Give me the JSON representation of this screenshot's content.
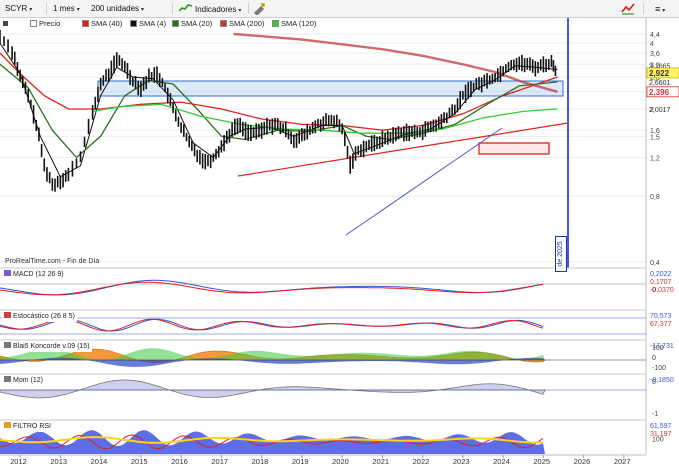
{
  "toolbar": {
    "symbol": "SCYR",
    "timeframe": "1 mes",
    "units": "200 unidades",
    "indicators": "Indicadores"
  },
  "colors": {
    "price": "#111111",
    "sma40": "#e02020",
    "sma4": "#111111",
    "sma20": "#2e6e1e",
    "sma200": "#c03a3a",
    "sma120": "#33cc33",
    "vline": "#1f2fd0",
    "zone_blue": "#2f6fd6",
    "zone_red": "#e03030"
  },
  "legend": [
    {
      "label": "Precio",
      "color": "#ffffff"
    },
    {
      "label": "SMA (40)",
      "color": "#e02020"
    },
    {
      "label": "SMA (4)",
      "color": "#111111"
    },
    {
      "label": "SMA (20)",
      "color": "#2e6e1e"
    },
    {
      "label": "SMA (200)",
      "color": "#c03a3a"
    },
    {
      "label": "SMA (120)",
      "color": "#33cc33"
    }
  ],
  "footer": "ProRealTime.com - Fin de Día",
  "vline_label": "de 2025",
  "panels": [
    {
      "label": "MACD (12 26 9)",
      "values": [
        "0,2022",
        "0,1707",
        "-0,0370"
      ],
      "ticks": [
        "0"
      ]
    },
    {
      "label": "Estocástico (26 8 5)",
      "values": [
        "70,573",
        "67,377"
      ],
      "ticks": []
    },
    {
      "label": "Blai5 Koncorde v.09 (15)",
      "values": [
        "-17,731"
      ],
      "ticks": [
        "100",
        "0",
        "-100"
      ]
    },
    {
      "label": "Mom (12)",
      "values": [
        "-0,1850"
      ],
      "ticks": [
        "0",
        "-1"
      ]
    },
    {
      "label": "FILTRO RSI",
      "values": [
        "61,597",
        "31,197"
      ],
      "ticks": [
        "100"
      ]
    }
  ],
  "chart_data": {
    "type": "line",
    "yscale": "log",
    "price_axis_ticks": [
      "4,4",
      "4",
      "3,6",
      "3,2",
      "2,8",
      "2,4",
      "2",
      "1,6",
      "1,5",
      "1,2",
      "0,8",
      "0,4"
    ],
    "axis_value_labels": [
      {
        "text": "3,1665",
        "value": 3.1665
      },
      {
        "text": "3,0300",
        "value": 3.03
      },
      {
        "text": "2,922",
        "value": 2.922,
        "highlight": true
      },
      {
        "text": "2,6601",
        "value": 2.6601
      },
      {
        "text": "2,396",
        "value": 2.396,
        "highlight": true
      },
      {
        "text": "2,0017",
        "value": 2.0017
      }
    ],
    "x_labels": [
      "2012",
      "2013",
      "2014",
      "2015",
      "2016",
      "2017",
      "2018",
      "2019",
      "2020",
      "2021",
      "2022",
      "2023",
      "2024",
      "2025",
      "2026",
      "2027"
    ],
    "price": [
      [
        2011.5,
        4.3
      ],
      [
        2011.8,
        3.7
      ],
      [
        2012.0,
        2.8
      ],
      [
        2012.2,
        2.3
      ],
      [
        2012.4,
        1.7
      ],
      [
        2012.6,
        1.1
      ],
      [
        2012.8,
        0.9
      ],
      [
        2013.0,
        0.95
      ],
      [
        2013.2,
        1.0
      ],
      [
        2013.5,
        1.2
      ],
      [
        2013.8,
        1.9
      ],
      [
        2014.0,
        2.6
      ],
      [
        2014.2,
        2.9
      ],
      [
        2014.4,
        3.35
      ],
      [
        2014.6,
        3.15
      ],
      [
        2014.8,
        2.7
      ],
      [
        2015.0,
        2.5
      ],
      [
        2015.2,
        2.8
      ],
      [
        2015.4,
        2.9
      ],
      [
        2015.6,
        2.5
      ],
      [
        2015.8,
        2.0
      ],
      [
        2016.0,
        1.65
      ],
      [
        2016.2,
        1.4
      ],
      [
        2016.4,
        1.25
      ],
      [
        2016.6,
        1.15
      ],
      [
        2016.8,
        1.2
      ],
      [
        2017.0,
        1.35
      ],
      [
        2017.2,
        1.55
      ],
      [
        2017.4,
        1.7
      ],
      [
        2017.6,
        1.6
      ],
      [
        2017.8,
        1.55
      ],
      [
        2018.0,
        1.6
      ],
      [
        2018.2,
        1.7
      ],
      [
        2018.4,
        1.68
      ],
      [
        2018.6,
        1.6
      ],
      [
        2018.8,
        1.45
      ],
      [
        2019.0,
        1.5
      ],
      [
        2019.2,
        1.6
      ],
      [
        2019.4,
        1.7
      ],
      [
        2019.6,
        1.75
      ],
      [
        2019.8,
        1.78
      ],
      [
        2020.0,
        1.62
      ],
      [
        2020.2,
        1.12
      ],
      [
        2020.4,
        1.3
      ],
      [
        2020.6,
        1.35
      ],
      [
        2020.8,
        1.4
      ],
      [
        2021.0,
        1.45
      ],
      [
        2021.2,
        1.5
      ],
      [
        2021.4,
        1.55
      ],
      [
        2021.6,
        1.58
      ],
      [
        2021.8,
        1.55
      ],
      [
        2022.0,
        1.6
      ],
      [
        2022.2,
        1.65
      ],
      [
        2022.4,
        1.72
      ],
      [
        2022.6,
        1.85
      ],
      [
        2022.8,
        2.0
      ],
      [
        2023.0,
        2.3
      ],
      [
        2023.2,
        2.5
      ],
      [
        2023.4,
        2.6
      ],
      [
        2023.6,
        2.7
      ],
      [
        2023.8,
        2.8
      ],
      [
        2024.0,
        3.0
      ],
      [
        2024.2,
        3.2
      ],
      [
        2024.4,
        3.25
      ],
      [
        2024.6,
        3.2
      ],
      [
        2024.8,
        3.1
      ],
      [
        2025.0,
        3.2
      ],
      [
        2025.2,
        3.25
      ],
      [
        2025.35,
        2.922
      ]
    ],
    "series": [
      {
        "name": "SMA (40)",
        "color": "#e02020",
        "points": [
          [
            2011.5,
            3.6
          ],
          [
            2012.0,
            2.9
          ],
          [
            2012.6,
            2.3
          ],
          [
            2013.2,
            2.0
          ],
          [
            2014.0,
            2.0
          ],
          [
            2015.0,
            2.1
          ],
          [
            2016.0,
            2.15
          ],
          [
            2017.0,
            2.0
          ],
          [
            2018.0,
            1.8
          ],
          [
            2019.0,
            1.7
          ],
          [
            2020.0,
            1.68
          ],
          [
            2021.0,
            1.6
          ],
          [
            2022.0,
            1.68
          ],
          [
            2023.0,
            1.9
          ],
          [
            2024.0,
            2.3
          ],
          [
            2025.35,
            2.8
          ]
        ]
      },
      {
        "name": "SMA (4)",
        "color": "#111111",
        "points": [
          [
            2011.5,
            4.0
          ],
          [
            2012.0,
            2.9
          ],
          [
            2012.5,
            1.5
          ],
          [
            2013.0,
            0.98
          ],
          [
            2013.5,
            1.1
          ],
          [
            2014.0,
            2.3
          ],
          [
            2014.4,
            3.1
          ],
          [
            2014.8,
            2.8
          ],
          [
            2015.3,
            2.75
          ],
          [
            2015.8,
            2.2
          ],
          [
            2016.3,
            1.4
          ],
          [
            2016.8,
            1.2
          ],
          [
            2017.2,
            1.5
          ],
          [
            2017.6,
            1.62
          ],
          [
            2018.2,
            1.65
          ],
          [
            2018.8,
            1.5
          ],
          [
            2019.5,
            1.68
          ],
          [
            2020.0,
            1.68
          ],
          [
            2020.3,
            1.25
          ],
          [
            2020.8,
            1.35
          ],
          [
            2021.5,
            1.52
          ],
          [
            2022.2,
            1.62
          ],
          [
            2022.8,
            1.9
          ],
          [
            2023.3,
            2.45
          ],
          [
            2023.8,
            2.72
          ],
          [
            2024.3,
            3.15
          ],
          [
            2024.8,
            3.1
          ],
          [
            2025.35,
            3.03
          ]
        ]
      },
      {
        "name": "SMA (20)",
        "color": "#2e6e1e",
        "points": [
          [
            2011.5,
            3.2
          ],
          [
            2012.2,
            2.5
          ],
          [
            2012.8,
            1.6
          ],
          [
            2013.4,
            1.2
          ],
          [
            2014.0,
            1.5
          ],
          [
            2014.6,
            2.3
          ],
          [
            2015.2,
            2.7
          ],
          [
            2015.8,
            2.6
          ],
          [
            2016.4,
            2.0
          ],
          [
            2017.0,
            1.5
          ],
          [
            2017.6,
            1.45
          ],
          [
            2018.4,
            1.6
          ],
          [
            2019.2,
            1.58
          ],
          [
            2020.0,
            1.68
          ],
          [
            2020.6,
            1.5
          ],
          [
            2021.2,
            1.45
          ],
          [
            2022.0,
            1.55
          ],
          [
            2022.8,
            1.7
          ],
          [
            2023.6,
            2.1
          ],
          [
            2024.4,
            2.55
          ],
          [
            2025.35,
            2.66
          ]
        ]
      },
      {
        "name": "SMA (200)",
        "color": "#c03a3a",
        "points": [
          [
            2017.3,
            4.4
          ],
          [
            2018.0,
            4.3
          ],
          [
            2019.0,
            4.15
          ],
          [
            2020.0,
            3.95
          ],
          [
            2021.0,
            3.75
          ],
          [
            2022.0,
            3.5
          ],
          [
            2023.0,
            3.2
          ],
          [
            2023.8,
            2.95
          ],
          [
            2024.5,
            2.65
          ],
          [
            2025.35,
            2.396
          ]
        ]
      },
      {
        "name": "SMA (120)",
        "color": "#33cc33",
        "points": [
          [
            2013.8,
            1.95
          ],
          [
            2014.5,
            2.05
          ],
          [
            2015.5,
            2.1
          ],
          [
            2016.5,
            1.85
          ],
          [
            2017.5,
            1.7
          ],
          [
            2018.5,
            1.62
          ],
          [
            2019.5,
            1.6
          ],
          [
            2020.5,
            1.55
          ],
          [
            2021.5,
            1.55
          ],
          [
            2022.5,
            1.62
          ],
          [
            2023.5,
            1.82
          ],
          [
            2024.5,
            1.95
          ],
          [
            2025.35,
            2.0017
          ]
        ]
      }
    ]
  }
}
